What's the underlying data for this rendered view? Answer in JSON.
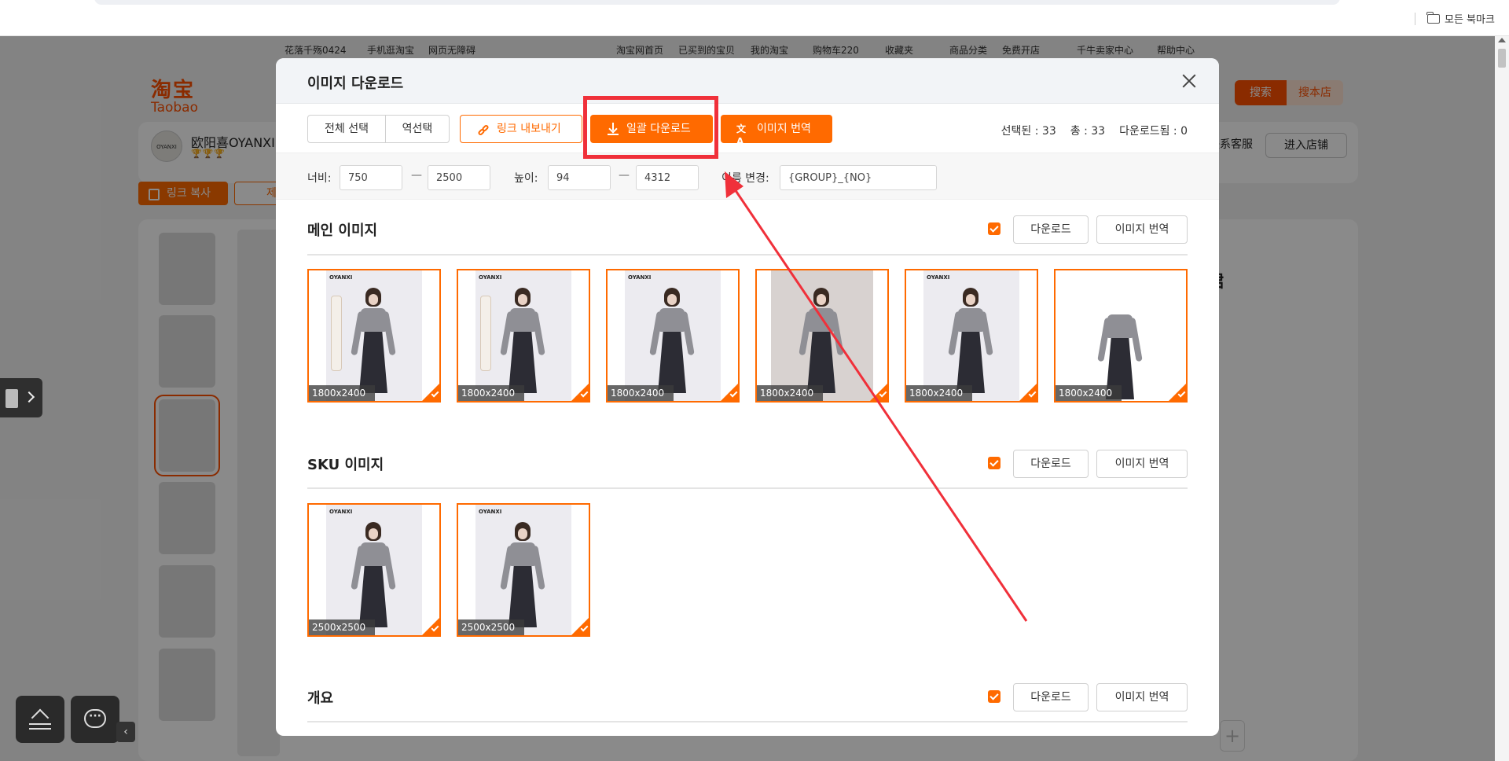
{
  "browser": {
    "bookmarks_label": "모든 북마크"
  },
  "taobao": {
    "topnav": [
      "花落千殇0424",
      "手机逛淘宝",
      "网页无障碍",
      "淘宝网首页",
      "已买到的宝贝",
      "我的淘宝",
      "购物车220",
      "收藏夹",
      "商品分类",
      "免费开店",
      "千牛卖家中心",
      "帮助中心"
    ],
    "logo": {
      "cn": "淘宝",
      "en": "Taobao"
    },
    "search_button": "搜索",
    "search_shop_button": "搜本店",
    "store_name": "欧阳喜OYANXI",
    "store_avatar_text": "OYANXI",
    "store_medals": "🏆🏆🏆",
    "customer_service": "联系客服",
    "enter_store": "进入店铺",
    "copy_link": "링크 복사",
    "second_button": "제",
    "title_fragment": "裙"
  },
  "modal": {
    "title": "이미지 다운로드",
    "toolbar": {
      "select_all": "전체 선택",
      "invert_select": "역선택",
      "export_links": "링크 내보내기",
      "bulk_download": "일괄 다운로드",
      "translate_images": "이미지 번역"
    },
    "stats": {
      "selected": "선택된 : 33",
      "total": "총 : 33",
      "downloaded": "다운로드됨 : 0"
    },
    "filter": {
      "width_label": "너비:",
      "width_min": "750",
      "width_max": "2500",
      "height_label": "높이:",
      "height_min": "94",
      "height_max": "4312",
      "rename_label": "이름 변경:",
      "rename_value": "{GROUP}_{NO}"
    },
    "section_download": "다운로드",
    "section_translate": "이미지 번역",
    "brand_mark": "OYANXI",
    "sections": [
      {
        "title": "메인 이미지",
        "images": [
          "1800x2400",
          "1800x2400",
          "1800x2400",
          "1800x2400",
          "1800x2400",
          "1800x2400"
        ]
      },
      {
        "title": "SKU 이미지",
        "images": [
          "2500x2500",
          "2500x2500"
        ]
      },
      {
        "title": "개요",
        "images": []
      }
    ]
  },
  "colors": {
    "accent": "#ff6a00",
    "annotation_red": "#f0303a"
  }
}
